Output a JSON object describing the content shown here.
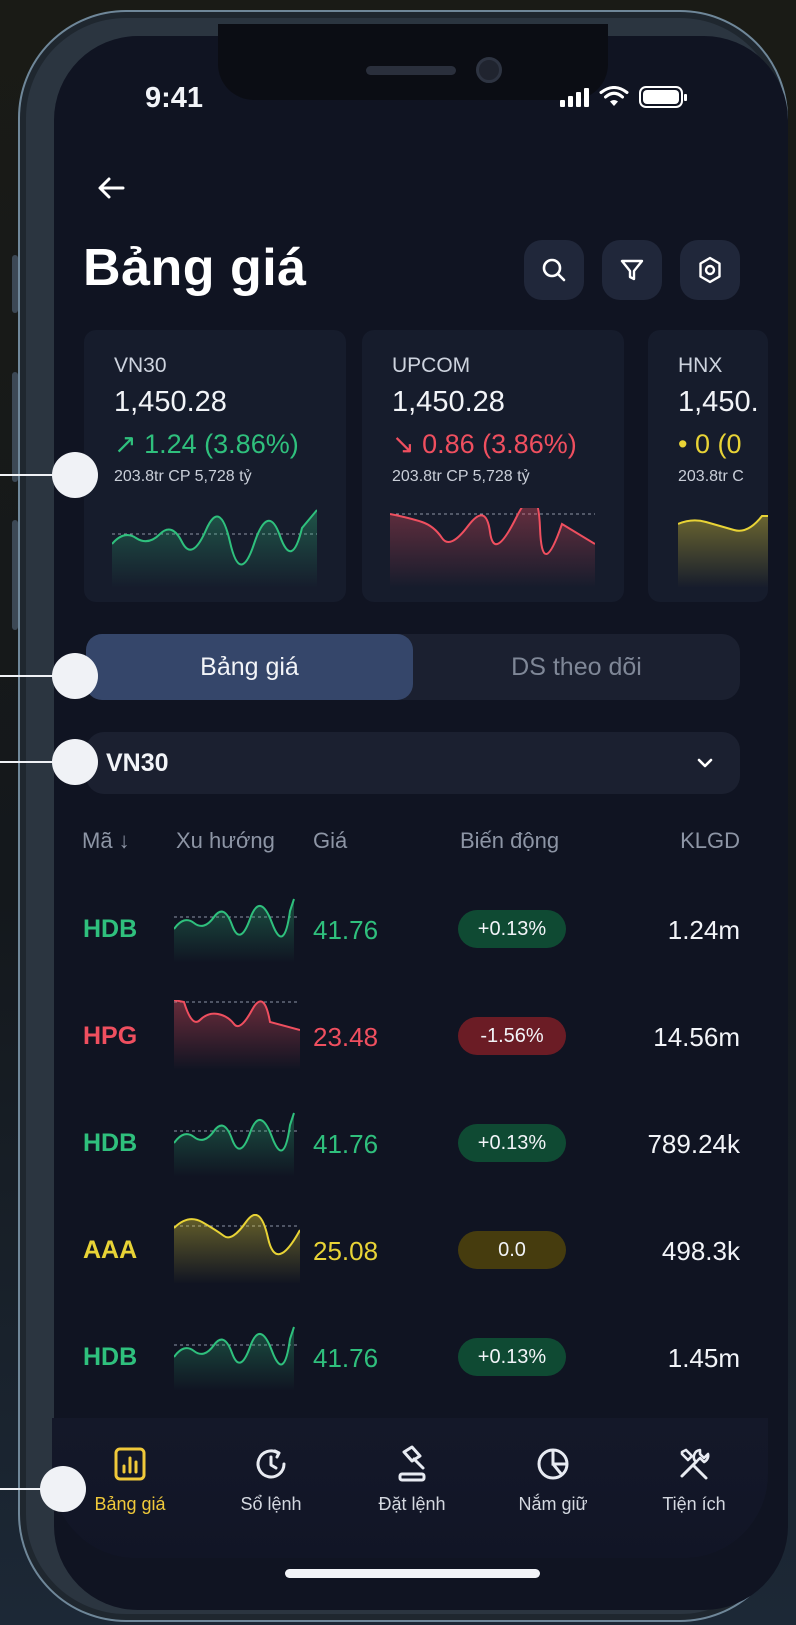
{
  "status": {
    "time": "9:41"
  },
  "header": {
    "title": "Bảng giá"
  },
  "indices": [
    {
      "name": "VN30",
      "value": "1,450.28",
      "change": "↗ 1.24 (3.86%)",
      "volume": "203.8tr CP  5,728 tỷ",
      "trend": "up",
      "color": "#2fc07d"
    },
    {
      "name": "UPCOM",
      "value": "1,450.28",
      "change": "↘ 0.86 (3.86%)",
      "volume": "203.8tr CP  5,728 tỷ",
      "trend": "down",
      "color": "#ef4f5f"
    },
    {
      "name": "HNX",
      "value": "1,450.",
      "change": "• 0 (0",
      "volume": "203.8tr C",
      "trend": "flat",
      "color": "#e8d336"
    }
  ],
  "tabs": [
    {
      "label": "Bảng giá",
      "active": true
    },
    {
      "label": "DS theo dõi",
      "active": false
    }
  ],
  "dropdown": {
    "value": "VN30"
  },
  "table": {
    "headers": {
      "code": "Mã ↓",
      "trend": "Xu hướng",
      "price": "Giá",
      "change": "Biến động",
      "volume": "KLGD"
    },
    "rows": [
      {
        "code": "HDB",
        "price": "41.76",
        "change": "+0.13%",
        "volume": "1.24m",
        "state": "green"
      },
      {
        "code": "HPG",
        "price": "23.48",
        "change": "-1.56%",
        "volume": "14.56m",
        "state": "red"
      },
      {
        "code": "HDB",
        "price": "41.76",
        "change": "+0.13%",
        "volume": "789.24k",
        "state": "green"
      },
      {
        "code": "AAA",
        "price": "25.08",
        "change": "0.0",
        "volume": "498.3k",
        "state": "yellow"
      },
      {
        "code": "HDB",
        "price": "41.76",
        "change": "+0.13%",
        "volume": "1.45m",
        "state": "green"
      }
    ]
  },
  "bottom_nav": [
    {
      "label": "Bảng giá",
      "icon": "chart-bar-icon",
      "active": true
    },
    {
      "label": "Sổ lệnh",
      "icon": "history-icon",
      "active": false
    },
    {
      "label": "Đặt lệnh",
      "icon": "auction-icon",
      "active": false
    },
    {
      "label": "Nắm giữ",
      "icon": "pie-chart-icon",
      "active": false
    },
    {
      "label": "Tiện ích",
      "icon": "tools-icon",
      "active": false
    }
  ],
  "colors": {
    "up": "#2fc07d",
    "down": "#ef4f5f",
    "flat": "#e8d336",
    "accent": "#f0c93a",
    "background": "#101422"
  }
}
